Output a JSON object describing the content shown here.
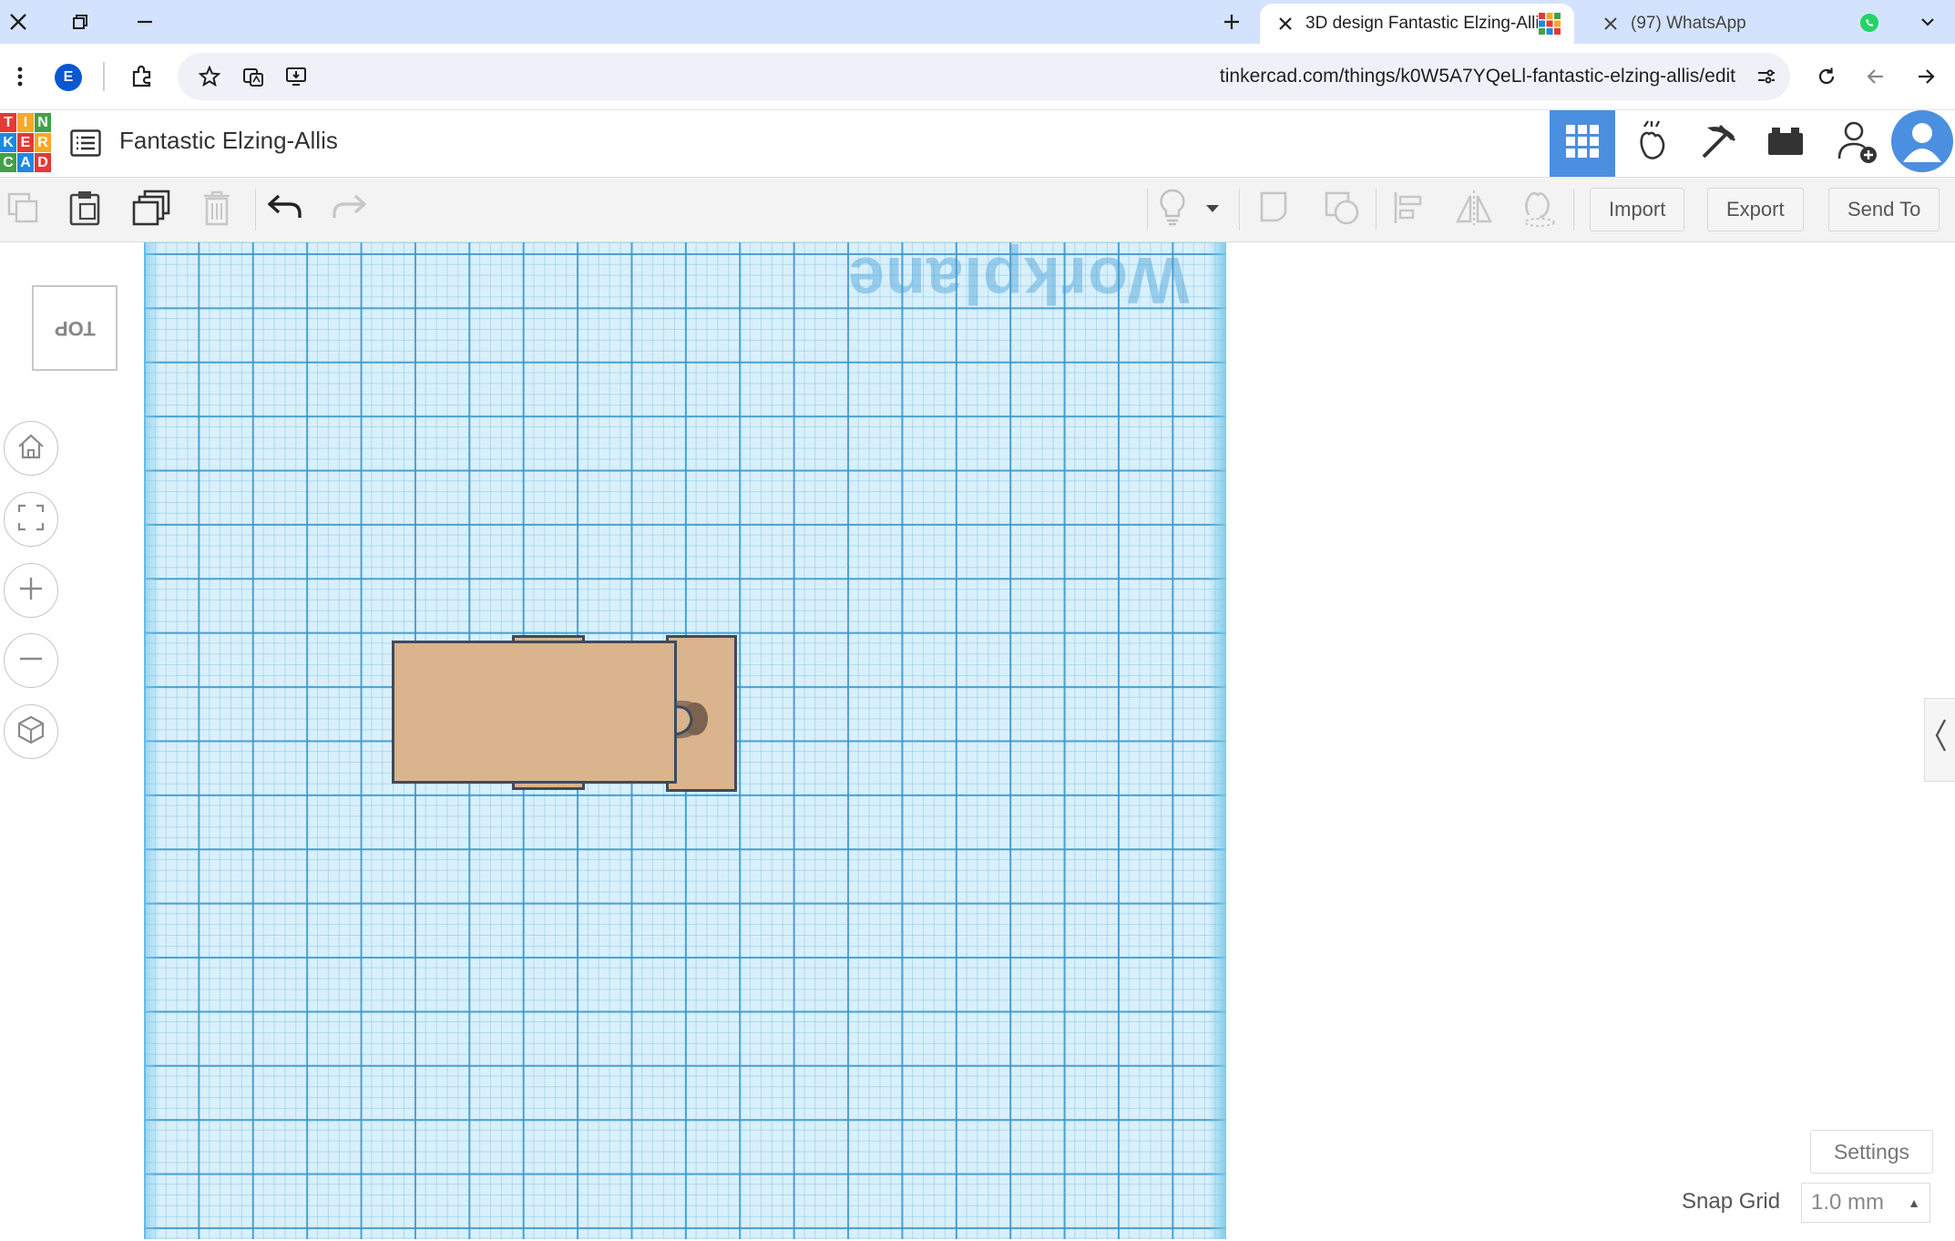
{
  "browser": {
    "tabs": [
      {
        "title": "3D design Fantastic Elzing-Allis",
        "active": true
      },
      {
        "title": "(97) WhatsApp",
        "active": false
      }
    ],
    "url": "tinkercad.com/things/k0W5A7YQeLl-fantastic-elzing-allis/edit",
    "profile_initial": "E"
  },
  "app": {
    "logo_letters": [
      "T",
      "I",
      "N",
      "K",
      "E",
      "R",
      "C",
      "A",
      "D"
    ],
    "logo_colors": [
      "#e53935",
      "#f9a825",
      "#43a047",
      "#1e88e5",
      "#e53935",
      "#f9a825",
      "#43a047",
      "#1e88e5",
      "#e53935"
    ],
    "design_title": "Fantastic Elzing-Allis"
  },
  "toolbar": {
    "import_label": "Import",
    "export_label": "Export",
    "send_to_label": "Send To"
  },
  "workplane": {
    "label": "Workplane",
    "view_cube_label": "TOP"
  },
  "bottom": {
    "settings_label": "Settings",
    "snap_grid_label": "Snap Grid",
    "snap_grid_value": "1.0 mm"
  },
  "colors": {
    "accent": "#4b8fe0",
    "workplane": "#d9f0fb",
    "shape_fill": "#d9b48c",
    "shape_stroke": "#3e4a5e"
  }
}
